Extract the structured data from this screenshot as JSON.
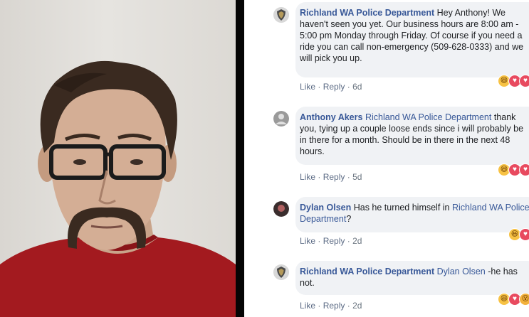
{
  "comments": [
    {
      "author": "Richland WA Police Department",
      "text": " Hey Anthony! We haven't seen you yet. Our business hours are 8:00 am - 5:00 pm Monday through Friday. Of course if you need a ride you can call non-emergency (509-628-0333) and we will pick you up.",
      "like": "Like",
      "reply": "Reply",
      "time": "6d",
      "avatar_icon": "police-badge-icon",
      "reactions": [
        "haha",
        "like",
        "like"
      ]
    },
    {
      "author": "Anthony Akers",
      "mention": "Richland WA Police Department",
      "text": " thank you, tying up a couple loose ends since i will probably be in there for a month. Should be in there in the next 48 hours.",
      "like": "Like",
      "reply": "Reply",
      "time": "5d",
      "avatar_icon": "user-avatar-icon",
      "reactions": [
        "haha",
        "like",
        "like"
      ]
    },
    {
      "author": "Dylan Olsen",
      "text": " Has he turned himself in ",
      "mention": "Richland WA Police Department",
      "text_after": "?",
      "like": "Like",
      "reply": "Reply",
      "time": "2d",
      "avatar_icon": "user-avatar-icon",
      "reactions": [
        "haha",
        "like"
      ]
    },
    {
      "author": "Richland WA Police Department",
      "mention": "Dylan Olsen",
      "text": " -he has not.",
      "like": "Like",
      "reply": "Reply",
      "time": "2d",
      "avatar_icon": "police-badge-icon",
      "reactions": [
        "haha",
        "like",
        "wow"
      ]
    }
  ],
  "separator": "·",
  "colors": {
    "author_link": "#385898",
    "bubble": "#f0f2f5",
    "shirt": "#a31a1f"
  }
}
